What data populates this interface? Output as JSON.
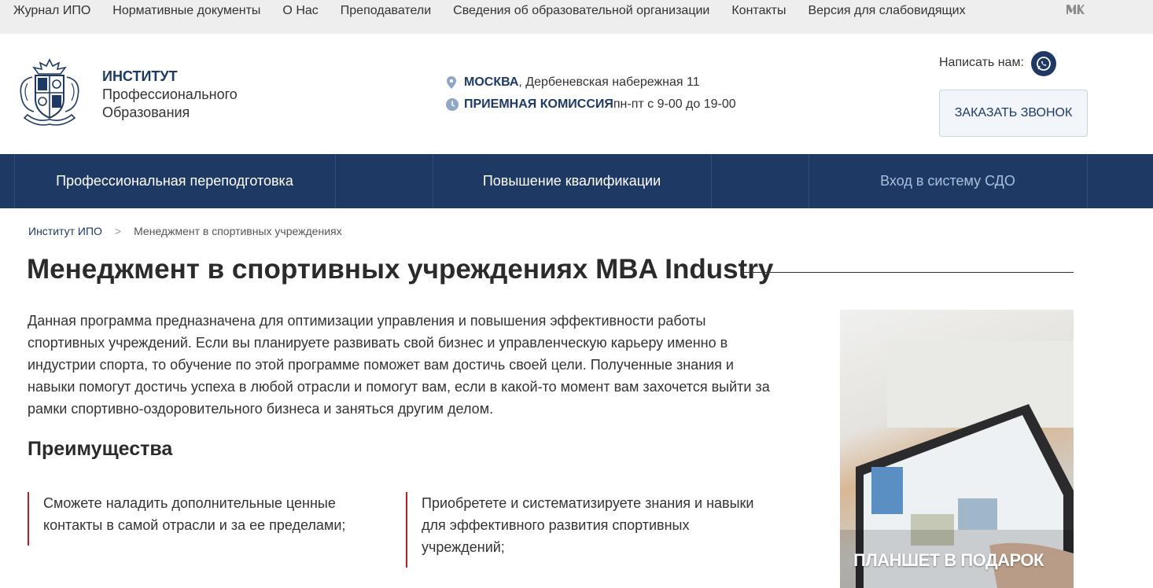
{
  "topbar": {
    "links": [
      "Журнал ИПО",
      "Нормативные документы",
      "О Нас",
      "Преподаватели",
      "Сведения об образовательной организации",
      "Контакты",
      "Версия для слабовидящих"
    ],
    "vk_icon": "vk-icon"
  },
  "brand": {
    "line1": "ИНСТИТУТ",
    "line2": "Профессионального",
    "line3": "Образования"
  },
  "contacts": {
    "city": "МОСКВА",
    "address": ", Дербеневская набережная 11",
    "admission_label": "ПРИЕМНАЯ КОМИССИЯ",
    "hours": " пн-пт с 9-00 до 19-00"
  },
  "header": {
    "write_label": "Написать нам:",
    "call_button": "ЗАКАЗАТЬ ЗВОНОК"
  },
  "mainnav": {
    "items": [
      "Профессиональная переподготовка",
      "Повышение квалификации",
      "Вход в систему СДО"
    ]
  },
  "breadcrumb": {
    "home": "Институт ИПО",
    "separator": ">",
    "current": "Менеджмент в спортивных учреждениях"
  },
  "page": {
    "title": "Менеджмент в спортивных учреждениях MBA Industry",
    "intro": "Данная программа предназначена для оптимизации управления и повышения эффективности работы спортивных учреждений. Если вы планируете развивать свой бизнес и управленческую карьеру именно в индустрии спорта, то обучение по этой программе поможет вам достичь своей цели. Полученные знания и навыки помогут достичь успеха в любой отрасли и помогут вам, если в какой-то момент вам захочется выйти за рамки спортивно-оздоровительного бизнеса и заняться другим делом.",
    "advantages_title": "Преимущества",
    "advantages": [
      "Сможете наладить дополнительные ценные контакты в самой отрасли и за ее пределами;",
      "Приобретете и систематизируете знания и навыки для эффективного развития спортивных учреждений;"
    ]
  },
  "promo": {
    "title": "ПЛАНШЕТ В ПОДАРОК"
  },
  "colors": {
    "brand_blue": "#1e3a64",
    "accent_red": "#b32024",
    "topbar_bg": "#eeeeee"
  }
}
